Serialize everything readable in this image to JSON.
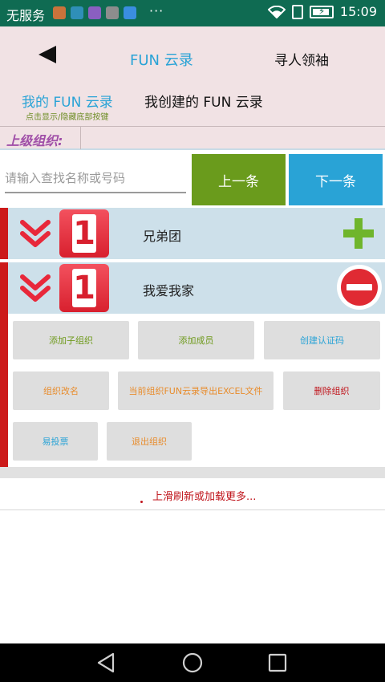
{
  "status_bar": {
    "carrier": "无服务",
    "more": "···",
    "time": "15:09",
    "app_colors": [
      "#c9733b",
      "#2f8fb8",
      "#8a5fc1",
      "#8d8d8d",
      "#3a8ee0"
    ]
  },
  "header": {
    "title": "FUN 云录",
    "find_leader": "寻人领袖",
    "tab_mine": "我的 FUN 云录",
    "tab_mine_sub": "点击显示/隐藏底部按键",
    "tab_created": "我创建的 FUN 云录"
  },
  "parent": {
    "label": "上级组织:"
  },
  "search": {
    "placeholder": "请输入查找名称或号码",
    "value": "",
    "prev_label": "上一条",
    "next_label": "下一条"
  },
  "orgs": [
    {
      "badge": "1",
      "name": "兄弟团",
      "action": "plus-icon"
    },
    {
      "badge": "1",
      "name": "我爱我家",
      "action": "minus-icon"
    }
  ],
  "actions": {
    "add_sub_org": "添加子组织",
    "add_member": "添加成员",
    "create_code": "创建认证码",
    "rename_org": "组织改名",
    "export_excel": "当前组织FUN云录导出EXCEL文件",
    "delete_org": "删除组织",
    "easy_vote": "易投票",
    "exit_org": "退出组织"
  },
  "load_more": {
    "text": "上滑刷新或加载更多..."
  },
  "colors": {
    "accent_blue": "#29a3d6",
    "accent_green": "#6a9b1c",
    "accent_red": "#cc1a1a",
    "status_bar": "#0f6b52",
    "header_bg": "#f1e2e4",
    "row_bg": "#cde0ea"
  }
}
